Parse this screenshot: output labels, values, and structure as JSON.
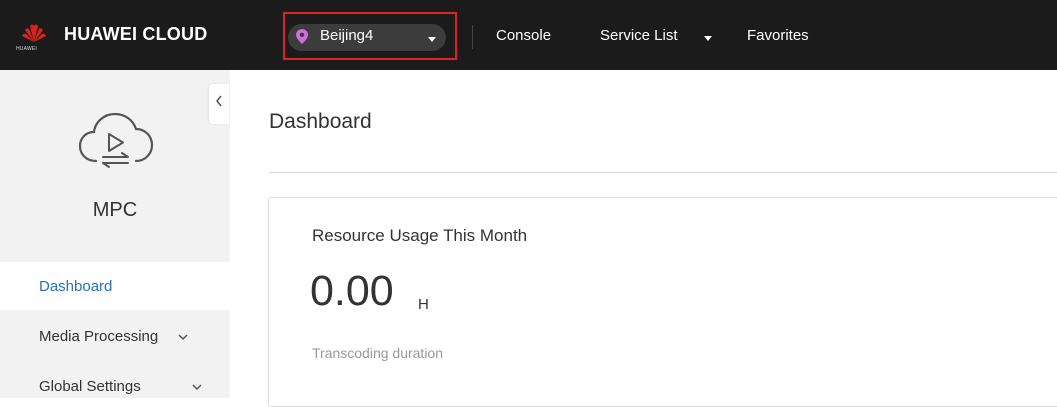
{
  "topbar": {
    "logo_text": "HUAWEI",
    "brand": "HUAWEI CLOUD",
    "region": "Beijing4",
    "nav": {
      "console": "Console",
      "service_list": "Service List",
      "favorites": "Favorites"
    }
  },
  "sidebar": {
    "service_name": "MPC",
    "items": [
      {
        "label": "Dashboard",
        "active": true
      },
      {
        "label": "Media Processing",
        "has_submenu": true
      },
      {
        "label": "Global Settings",
        "has_submenu": true
      }
    ]
  },
  "main": {
    "title": "Dashboard",
    "card": {
      "title": "Resource Usage This Month",
      "value": "0.00",
      "unit": "H",
      "caption": "Transcoding duration"
    }
  },
  "colors": {
    "topbar_bg": "#1b1b1b",
    "accent": "#2670c2",
    "highlight_frame": "#e0221f",
    "pin": "#d06be0",
    "logo_red": "#e0221f"
  }
}
